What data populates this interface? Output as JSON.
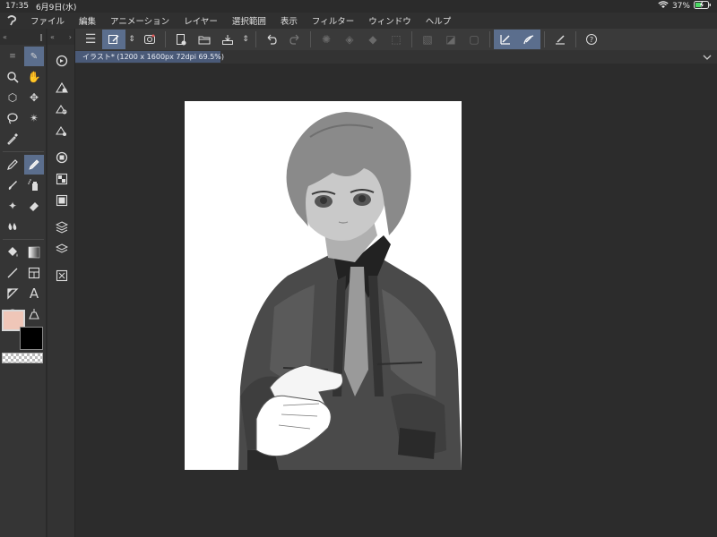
{
  "status": {
    "time": "17:35",
    "date": "6月9日(水)",
    "battery": "37%",
    "wifi_icon": "wifi-icon",
    "battery_icon": "battery-charging-icon"
  },
  "menu": {
    "logo_icon": "clip-studio-logo-icon",
    "items": [
      "ファイル",
      "編集",
      "アニメーション",
      "レイヤー",
      "選択範囲",
      "表示",
      "フィルター",
      "ウィンドウ",
      "ヘルプ"
    ]
  },
  "toolbar": {
    "icons": [
      "menu-icon",
      "quick-access-icon",
      "up-down-arrows-icon",
      "onion-skin-icon",
      "new-canvas-icon",
      "open-folder-icon",
      "save-icon",
      "up-down-arrows-icon",
      "undo-icon",
      "redo-icon",
      "clear-layer-icon",
      "fill-selection-icon",
      "invert-selection-icon",
      "transform-icon",
      "deselect-icon",
      "hide-selection-icon",
      "show-selection-icon",
      "snap-ruler-icon",
      "snap-special-ruler-icon",
      "snap-grid-icon",
      "help-icon"
    ],
    "accent_color": "#5b6e8d"
  },
  "document": {
    "tab_label": "イラスト* (1200 x 1600px 72dpi 69.5%)"
  },
  "tools": {
    "icons": [
      "zoom-icon",
      "hand-icon",
      "object-select-icon",
      "move-icon",
      "lasso-icon",
      "magic-wand-icon",
      "eyedropper-icon",
      "pen-icon",
      "pencil-icon",
      "brush-icon",
      "airbrush-icon",
      "eraser-icon",
      "decoration-icon",
      "blend-icon",
      "fill-icon",
      "gradient-icon",
      "line-figure-icon",
      "frame-border-icon",
      "ruler-icon",
      "text-icon",
      "balloon-icon",
      "correct-line-icon"
    ],
    "active_tool": "pencil-icon"
  },
  "colors": {
    "main": "#efc6b8",
    "sub": "#000000",
    "accent": "#5b6e8d"
  },
  "subtools": {
    "icons": [
      "navigator-icon",
      "layer-property-icon",
      "layer-search-icon",
      "layer-search-2-icon",
      "material-icon",
      "tool-property-icon",
      "sub-view-icon",
      "timeline-icon",
      "layers-icon",
      "layers-stack-icon",
      "canvas-icon"
    ]
  }
}
